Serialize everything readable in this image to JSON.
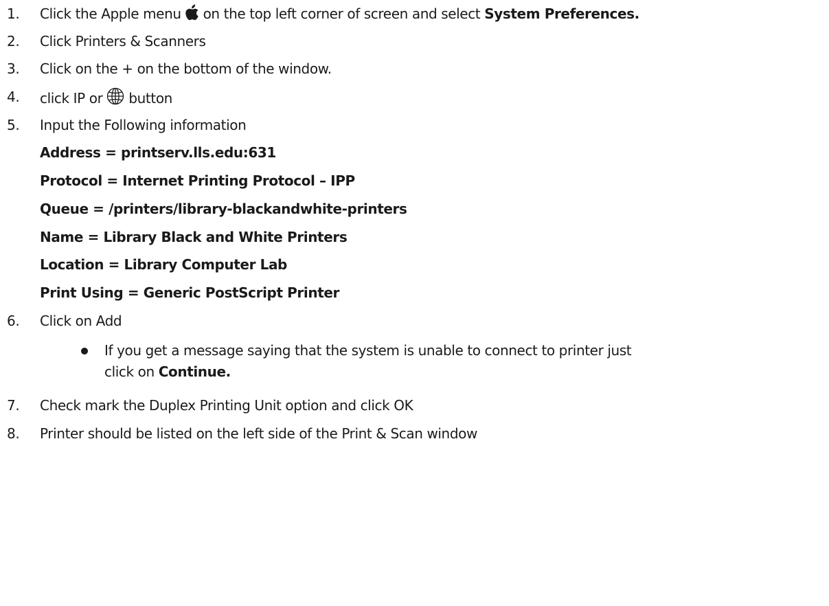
{
  "steps": [
    {
      "num": "1.",
      "pre": "Click the Apple menu",
      "icon": "apple-logo-icon",
      "mid": "on the top left corner of screen and select",
      "bold": "System Preferences."
    },
    {
      "num": "2.",
      "text": "Click Printers & Scanners"
    },
    {
      "num": "3.",
      "text": "Click on the + on the bottom of the window."
    },
    {
      "num": "4.",
      "pre": "click IP or",
      "icon": "globe-icon",
      "post": "button"
    },
    {
      "num": "5.",
      "text": "Input the Following information"
    },
    {
      "num": "6.",
      "text": "Click on Add"
    },
    {
      "num": "7.",
      "text": "Check mark the Duplex Printing Unit option and click OK"
    },
    {
      "num": "8.",
      "text": "Printer should be listed on the left side of the Print & Scan window"
    }
  ],
  "info_fields": [
    "Address = printserv.lls.edu:631",
    "Protocol = Internet Printing Protocol – IPP",
    "Queue = /printers/library-blackandwhite-printers",
    "Name = Library Black and White Printers",
    "Location = Library Computer Lab",
    "Print Using = Generic PostScript Printer"
  ],
  "note": {
    "line1": "If you get a message saying that the system is unable to connect to printer just",
    "line2_pre": "click on",
    "line2_bold": "Continue."
  }
}
